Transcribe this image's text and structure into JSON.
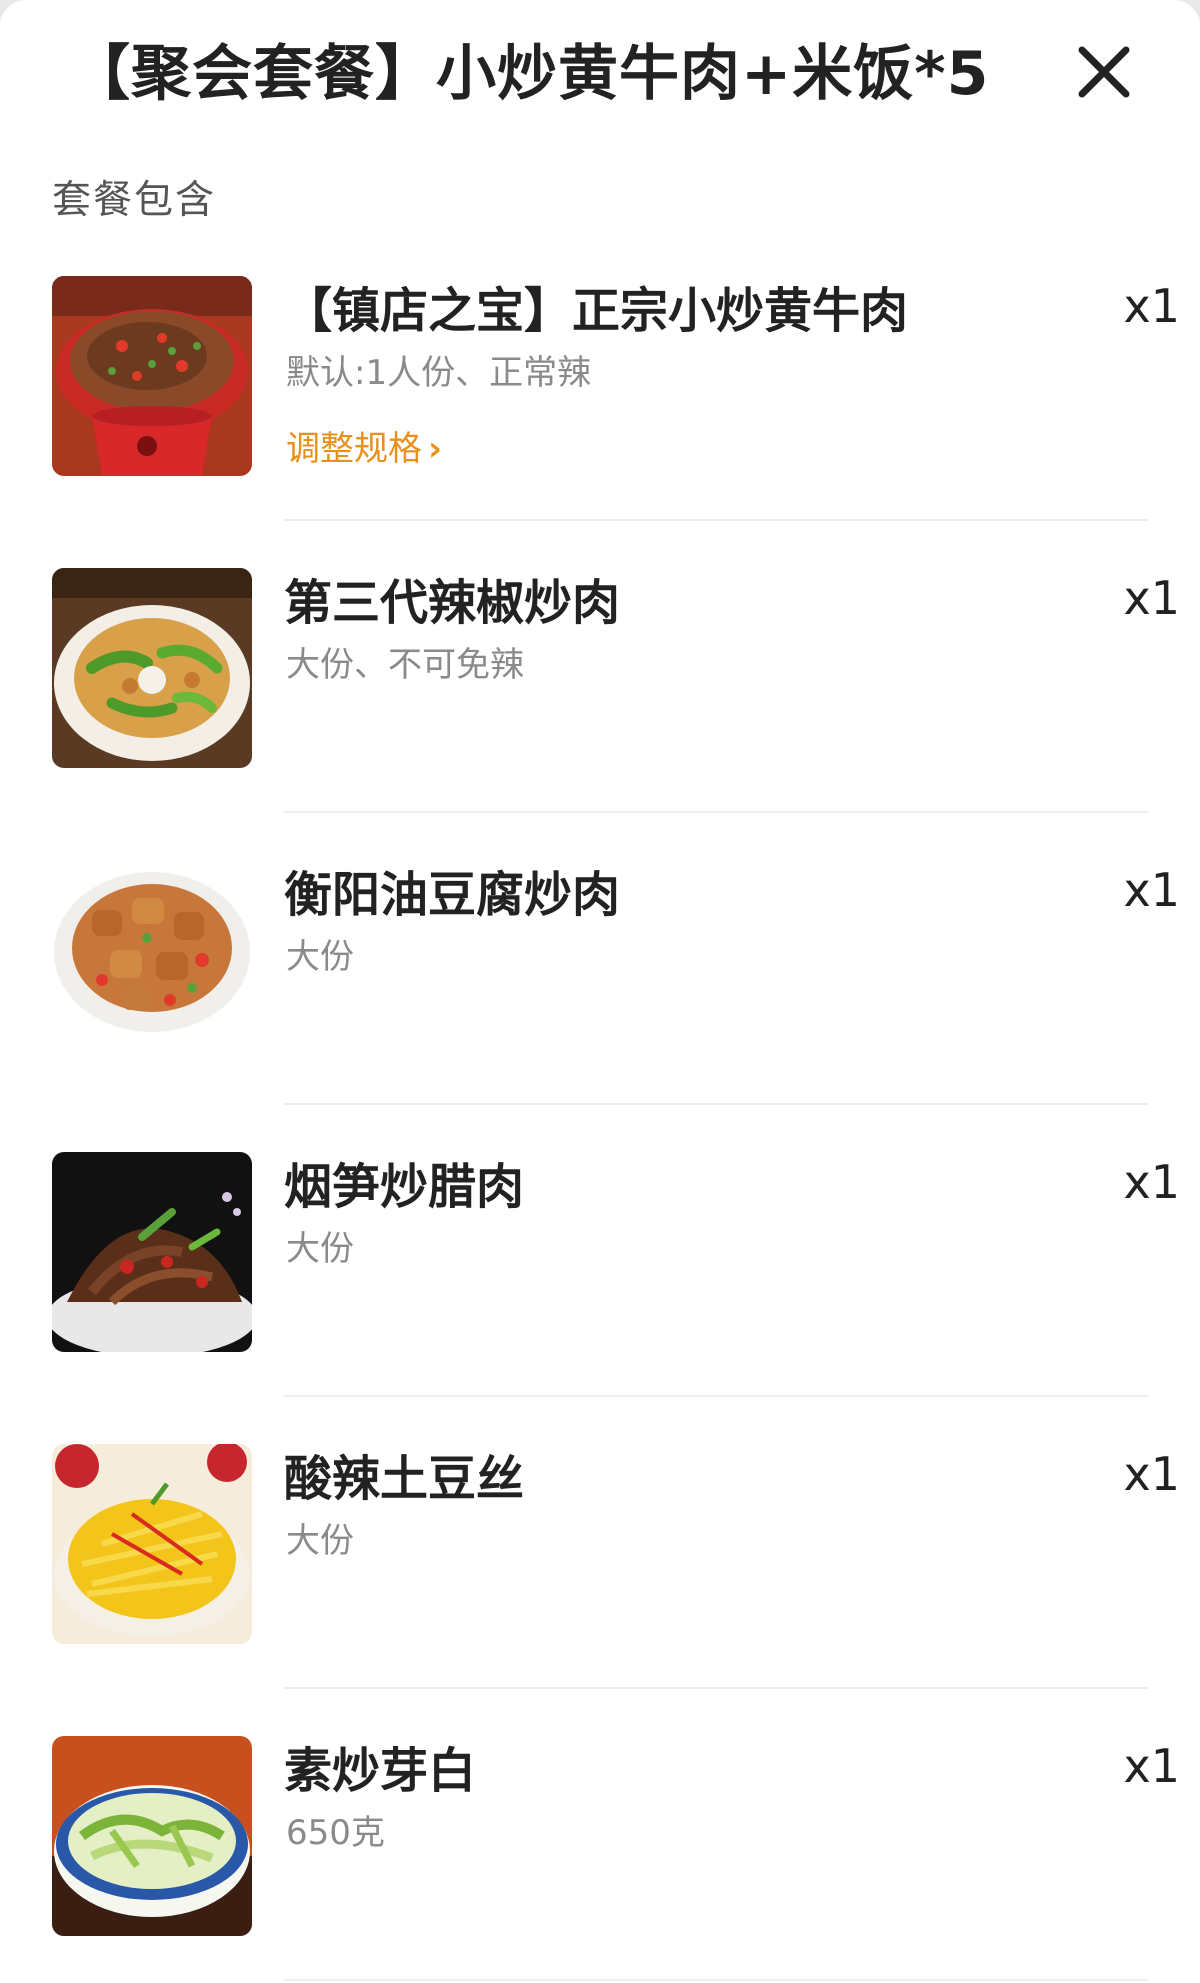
{
  "header": {
    "title": "【聚会套餐】小炒黄牛肉+米饭*5",
    "close_icon": "close-icon"
  },
  "section_label": "套餐包含",
  "items": [
    {
      "name": "【镇店之宝】正宗小炒黄牛肉",
      "spec": "默认:1人份、正常辣",
      "adjust_label": "调整规格",
      "qty": "x1",
      "image": "spicy-beef-dish-image"
    },
    {
      "name": "第三代辣椒炒肉",
      "spec": "大份、不可免辣",
      "qty": "x1",
      "image": "chili-pork-dish-image"
    },
    {
      "name": "衡阳油豆腐炒肉",
      "spec": "大份",
      "qty": "x1",
      "image": "tofu-pork-dish-image"
    },
    {
      "name": "烟笋炒腊肉",
      "spec": "大份",
      "qty": "x1",
      "image": "bamboo-bacon-dish-image"
    },
    {
      "name": "酸辣土豆丝",
      "spec": "大份",
      "qty": "x1",
      "image": "potato-shreds-dish-image"
    },
    {
      "name": "素炒芽白",
      "spec": "650克",
      "qty": "x1",
      "image": "cabbage-dish-image"
    }
  ],
  "colors": {
    "accent": "#e8901c",
    "text_primary": "#222222",
    "text_secondary": "#8a8a8a"
  }
}
